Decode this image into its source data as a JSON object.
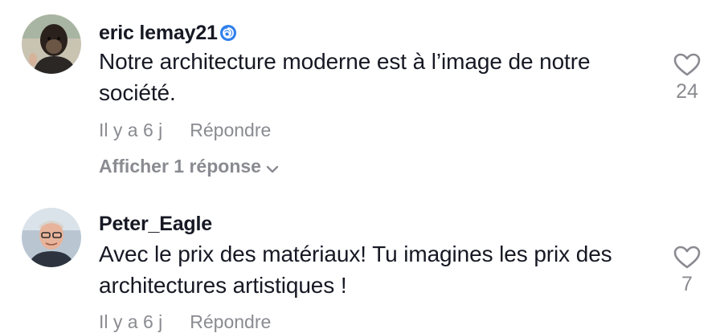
{
  "comments": [
    {
      "username": "eric lemay21",
      "username_icon": "swirl-emoji-icon",
      "text": "Notre architecture moderne est à l’image de notre société.",
      "time": "Il y a 6 j",
      "reply_label": "Répondre",
      "view_replies_label": "Afficher 1 réponse",
      "likes": "24"
    },
    {
      "username": "Peter_Eagle",
      "text": "Avec le prix des matériaux! Tu imagines les prix des architectures artistiques !",
      "time": "Il y a 6 j",
      "reply_label": "Répondre",
      "likes": "7"
    }
  ],
  "colors": {
    "text": "#161823",
    "muted": "#8a8b91",
    "swirl": "#2f80ed"
  }
}
